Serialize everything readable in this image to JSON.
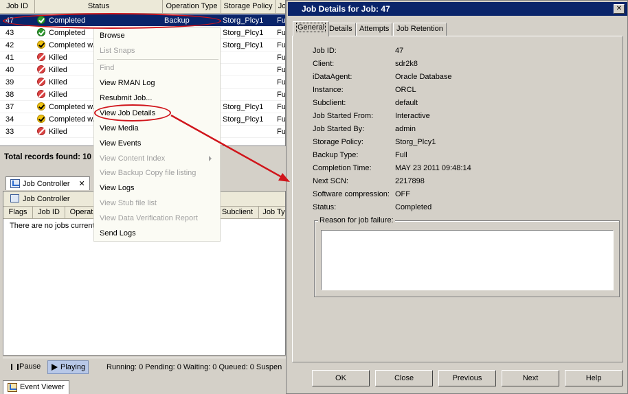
{
  "grid": {
    "columns": [
      "Job ID",
      "Status",
      "Operation Type",
      "Storage Policy",
      "Jo"
    ],
    "rows": [
      {
        "id": "47",
        "status": "Completed",
        "status_icon": "check-circle-icon",
        "op": "Backup",
        "policy": "Storg_Plcy1",
        "type": "Fu"
      },
      {
        "id": "43",
        "status": "Completed",
        "status_icon": "check-circle-icon",
        "op": "",
        "policy": "Storg_Plcy1",
        "type": "Fu"
      },
      {
        "id": "42",
        "status": "Completed w/",
        "status_icon": "warning-check-icon",
        "op": "",
        "policy": "Storg_Plcy1",
        "type": "Fu"
      },
      {
        "id": "41",
        "status": "Killed",
        "status_icon": "killed-icon",
        "op": "",
        "policy": "",
        "type": "Fu"
      },
      {
        "id": "40",
        "status": "Killed",
        "status_icon": "killed-icon",
        "op": "",
        "policy": "",
        "type": "Fu"
      },
      {
        "id": "39",
        "status": "Killed",
        "status_icon": "killed-icon",
        "op": "",
        "policy": "",
        "type": "Fu"
      },
      {
        "id": "38",
        "status": "Killed",
        "status_icon": "killed-icon",
        "op": "",
        "policy": "",
        "type": "Fu"
      },
      {
        "id": "37",
        "status": "Completed w/",
        "status_icon": "warning-check-icon",
        "op": "",
        "policy": "Storg_Plcy1",
        "type": "Fu"
      },
      {
        "id": "34",
        "status": "Completed w/",
        "status_icon": "warning-check-icon",
        "op": "",
        "policy": "Storg_Plcy1",
        "type": "Fu"
      },
      {
        "id": "33",
        "status": "Killed",
        "status_icon": "killed-icon",
        "op": "",
        "policy": "",
        "type": "Fu"
      }
    ],
    "total": "Total records found: 10"
  },
  "job_controller": {
    "tab_label": "Job Controller",
    "panel_title": "Job Controller",
    "columns": [
      "Flags",
      "Job ID",
      "Operat",
      "Subclient",
      "Job Ty"
    ],
    "empty_text": "There are no jobs current"
  },
  "statusbar": {
    "pause_label": "Pause",
    "play_label": "Playing",
    "counts": "Running: 0 Pending: 0 Waiting: 0 Queued: 0 Suspen"
  },
  "event_viewer": {
    "tab_label": "Event Viewer"
  },
  "context_menu": {
    "items": [
      {
        "label": "Browse",
        "enabled": true
      },
      {
        "label": "List Snaps",
        "enabled": false
      },
      {
        "label": "Find",
        "enabled": false
      },
      {
        "label": "View RMAN Log",
        "enabled": true
      },
      {
        "label": "Resubmit Job...",
        "enabled": true
      },
      {
        "label": "View Job Details",
        "enabled": true
      },
      {
        "label": "View Media",
        "enabled": true
      },
      {
        "label": "View Events",
        "enabled": true
      },
      {
        "label": "View Content Index",
        "enabled": false
      },
      {
        "label": "View Backup Copy file listing",
        "enabled": false
      },
      {
        "label": "View Logs",
        "enabled": true
      },
      {
        "label": "View Stub file list",
        "enabled": false
      },
      {
        "label": "View Data Verification Report",
        "enabled": false
      },
      {
        "label": "Send Logs",
        "enabled": true
      }
    ]
  },
  "dialog": {
    "title": "Job Details for Job: 47",
    "close_glyph": "✕",
    "tabs": [
      "General",
      "Details",
      "Attempts",
      "Job Retention"
    ],
    "active_tab": "General",
    "fields": [
      {
        "label": "Job ID:",
        "value": "47"
      },
      {
        "label": "Client:",
        "value": "sdr2k8"
      },
      {
        "label": "iDataAgent:",
        "value": "Oracle Database"
      },
      {
        "label": "Instance:",
        "value": "ORCL"
      },
      {
        "label": "Subclient:",
        "value": "default"
      },
      {
        "label": "Job Started From:",
        "value": "Interactive"
      },
      {
        "label": "Job Started By:",
        "value": "admin"
      },
      {
        "label": "Storage Policy:",
        "value": "Storg_Plcy1"
      },
      {
        "label": "Backup Type:",
        "value": "Full"
      },
      {
        "label": "Completion Time:",
        "value": "MAY 23 2011 09:48:14"
      },
      {
        "label": "Next SCN:",
        "value": "2217898"
      },
      {
        "label": "Software compression:",
        "value": "OFF"
      },
      {
        "label": "Status:",
        "value": "Completed"
      }
    ],
    "failure_label": "Reason for job failure:",
    "failure_text": "",
    "buttons": [
      "OK",
      "Close",
      "Previous",
      "Next",
      "Help"
    ]
  },
  "annotation_color": "#d0151b"
}
